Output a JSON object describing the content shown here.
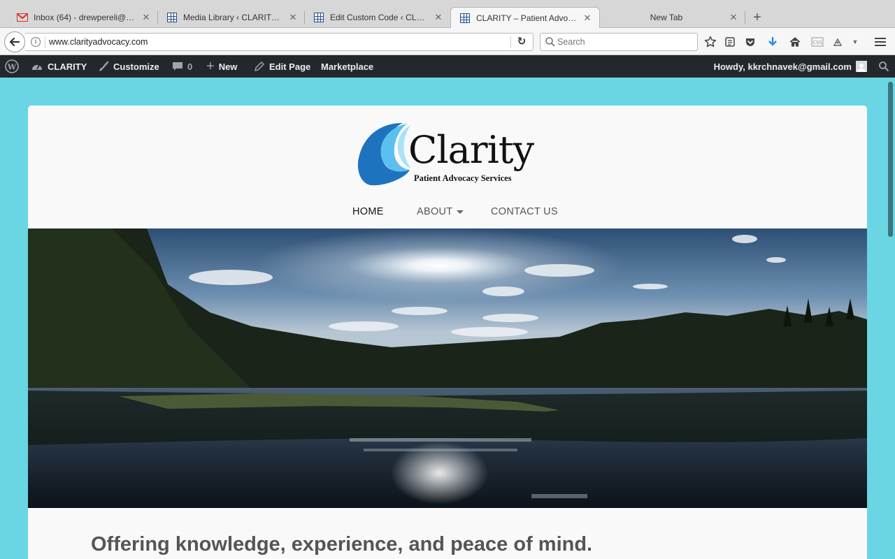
{
  "browser": {
    "tabs": [
      {
        "label": "Inbox (64) - drewpereli@g...",
        "icon": "gmail-icon",
        "active": false
      },
      {
        "label": "Media Library ‹ CLARITY —...",
        "icon": "wordpress-grid-icon",
        "active": false
      },
      {
        "label": "Edit Custom Code ‹ CLARI...",
        "icon": "wordpress-grid-icon",
        "active": false
      },
      {
        "label": "CLARITY – Patient Advocac...",
        "icon": "wordpress-grid-icon",
        "active": true
      },
      {
        "label": "New Tab",
        "icon": "",
        "active": false
      }
    ],
    "url": "www.clarityadvocacy.com",
    "search_placeholder": "Search"
  },
  "adminbar": {
    "site_name": "CLARITY",
    "customize": "Customize",
    "comments_count": "0",
    "new_label": "New",
    "edit_page": "Edit Page",
    "marketplace": "Marketplace",
    "howdy": "Howdy, kkrchnavek@gmail.com"
  },
  "site": {
    "logo_word": "Clarity",
    "logo_tagline": "Patient Advocacy Services",
    "nav": [
      {
        "label": "HOME",
        "current": true
      },
      {
        "label": "ABOUT",
        "has_dropdown": true
      },
      {
        "label": "CONTACT US"
      }
    ],
    "headline": "Offering knowledge, experience, and peace of mind."
  },
  "colors": {
    "page_background": "#6ad5e3",
    "admin_bar": "#23282d",
    "logo_blue_dark": "#1e73be",
    "logo_blue_light": "#7fd3f5"
  }
}
